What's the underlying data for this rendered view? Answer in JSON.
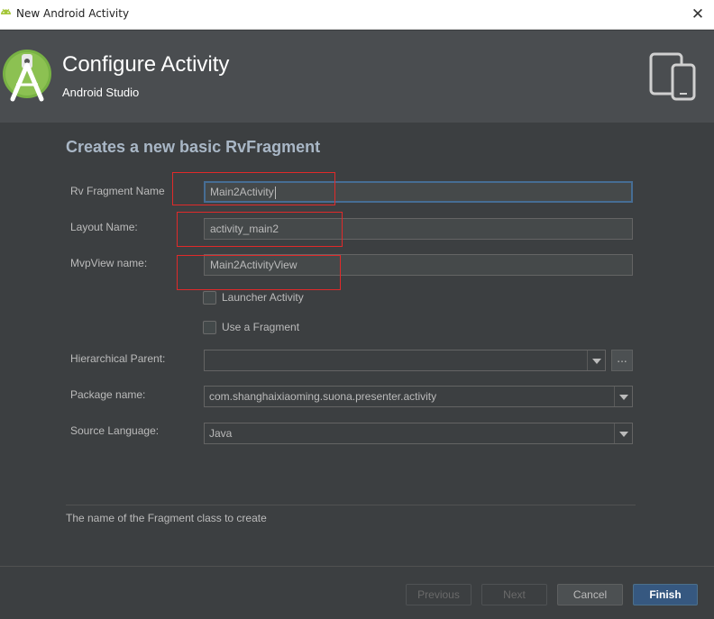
{
  "window": {
    "title": "New Android Activity",
    "close_glyph": "✕"
  },
  "header": {
    "title": "Configure Activity",
    "subtitle": "Android Studio"
  },
  "form": {
    "section_title": "Creates a new basic RvFragment",
    "fragment_name": {
      "label": "Rv Fragment Name",
      "value": "Main2Activity"
    },
    "layout_name": {
      "label": "Layout Name:",
      "value": "activity_main2"
    },
    "mvp_view_name": {
      "label": "MvpView name:",
      "value": "Main2ActivityView"
    },
    "launcher_activity": {
      "label": "Launcher Activity",
      "checked": false
    },
    "use_fragment": {
      "label": "Use a Fragment",
      "checked": false
    },
    "hierarchical_parent": {
      "label": "Hierarchical Parent:",
      "value": "",
      "browse_label": "..."
    },
    "package_name": {
      "label": "Package name:",
      "value": "com.shanghaixiaoming.suona.presenter.activity"
    },
    "source_language": {
      "label": "Source Language:",
      "value": "Java"
    }
  },
  "hint": "The name of the Fragment class to create",
  "buttons": {
    "previous": "Previous",
    "next": "Next",
    "cancel": "Cancel",
    "finish": "Finish"
  },
  "colors": {
    "background": "#3c3f41",
    "header": "#4a4d50",
    "accent": "#365880",
    "highlight_box": "#e02a2a",
    "android_green": "#a4c639"
  }
}
